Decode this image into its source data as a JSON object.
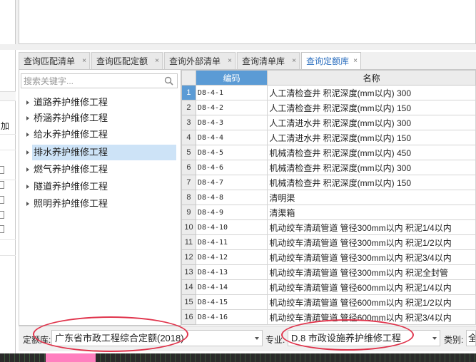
{
  "tabs": [
    {
      "label": "查询匹配清单",
      "close": "×"
    },
    {
      "label": "查询匹配定额",
      "close": "×"
    },
    {
      "label": "查询外部清单",
      "close": "×"
    },
    {
      "label": "查询清单库",
      "close": "×"
    },
    {
      "label": "查询定额库",
      "close": "×",
      "active": true
    }
  ],
  "left_strip": {
    "label": "加"
  },
  "search": {
    "placeholder": "搜索关键字...",
    "icon": "search-icon"
  },
  "tree": [
    {
      "label": "道路养护维修工程"
    },
    {
      "label": "桥涵养护维修工程"
    },
    {
      "label": "给水养护维修工程"
    },
    {
      "label": "排水养护维修工程",
      "selected": true
    },
    {
      "label": "燃气养护维修工程"
    },
    {
      "label": "隧道养护维修工程"
    },
    {
      "label": "照明养护维修工程"
    }
  ],
  "grid": {
    "columns": {
      "code": "编码",
      "name": "名称"
    },
    "rows": [
      {
        "n": "1",
        "code": "D8-4-1",
        "name": "人工清检查井 积泥深度(mm以内) 300"
      },
      {
        "n": "2",
        "code": "D8-4-2",
        "name": "人工清检查井 积泥深度(mm以内) 150"
      },
      {
        "n": "3",
        "code": "D8-4-3",
        "name": "人工清进水井 积泥深度(mm以内) 300"
      },
      {
        "n": "4",
        "code": "D8-4-4",
        "name": "人工清进水井 积泥深度(mm以内) 150"
      },
      {
        "n": "5",
        "code": "D8-4-5",
        "name": "机械清检查井 积泥深度(mm以内) 450"
      },
      {
        "n": "6",
        "code": "D8-4-6",
        "name": "机械清检查井 积泥深度(mm以内) 300"
      },
      {
        "n": "7",
        "code": "D8-4-7",
        "name": "机械清检查井 积泥深度(mm以内) 150"
      },
      {
        "n": "8",
        "code": "D8-4-8",
        "name": "清明渠"
      },
      {
        "n": "9",
        "code": "D8-4-9",
        "name": "清渠箱"
      },
      {
        "n": "10",
        "code": "D8-4-10",
        "name": "机动绞车清疏管道 管径300mm以内 积泥1/4以内"
      },
      {
        "n": "11",
        "code": "D8-4-11",
        "name": "机动绞车清疏管道 管径300mm以内 积泥1/2以内"
      },
      {
        "n": "12",
        "code": "D8-4-12",
        "name": "机动绞车清疏管道 管径300mm以内 积泥3/4以内"
      },
      {
        "n": "13",
        "code": "D8-4-13",
        "name": "机动绞车清疏管道 管径300mm以内 积泥全封管"
      },
      {
        "n": "14",
        "code": "D8-4-14",
        "name": "机动绞车清疏管道 管径600mm以内 积泥1/4以内"
      },
      {
        "n": "15",
        "code": "D8-4-15",
        "name": "机动绞车清疏管道 管径600mm以内 积泥1/2以内"
      },
      {
        "n": "16",
        "code": "D8-4-16",
        "name": "机动绞车清疏管道 管径600mm以内 积泥3/4以内"
      }
    ]
  },
  "bottom": {
    "quota_label": "定额库:",
    "quota_value": "广东省市政工程综合定额(2018)",
    "major_label": "专业:",
    "major_value": "D.8 市政设施养护维修工程",
    "category_label": "类别:",
    "category_value": "全"
  },
  "colors": {
    "accent": "#5b9bd5",
    "selection": "#cde3f7",
    "annotation": "#e0344c"
  }
}
